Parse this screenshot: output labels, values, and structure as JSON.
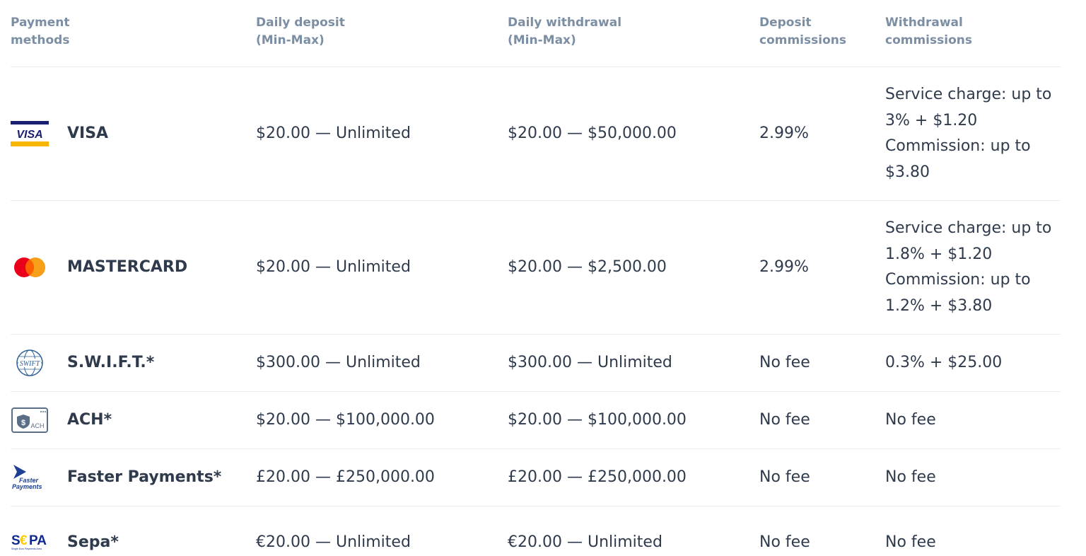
{
  "headers": {
    "method": "Payment\nmethods",
    "deposit": "Daily deposit\n(Min-Max)",
    "withdrawal": "Daily withdrawal\n(Min-Max)",
    "deposit_commissions": "Deposit\ncommissions",
    "withdrawal_commissions": "Withdrawal\ncommissions"
  },
  "rows": [
    {
      "method": "VISA",
      "icon": "visa-logo",
      "deposit": "$20.00 — Unlimited",
      "withdrawal": "$20.00 — $50,000.00",
      "deposit_commission": "2.99%",
      "withdrawal_commission": [
        "Service charge: up to",
        "3% + $1.20",
        "Commission: up to",
        "$3.80"
      ]
    },
    {
      "method": "MASTERCARD",
      "icon": "mastercard-logo",
      "deposit": "$20.00 — Unlimited",
      "withdrawal": "$20.00 — $2,500.00",
      "deposit_commission": "2.99%",
      "withdrawal_commission": [
        "Service charge: up to",
        "1.8% + $1.20",
        "Commission: up to",
        "1.2% + $3.80"
      ]
    },
    {
      "method": "S.W.I.F.T.*",
      "icon": "swift-logo",
      "deposit": "$300.00 — Unlimited",
      "withdrawal": "$300.00 — Unlimited",
      "deposit_commission": "No fee",
      "withdrawal_commission": [
        "0.3% + $25.00"
      ]
    },
    {
      "method": "ACH*",
      "icon": "ach-logo",
      "deposit": "$20.00 — $100,000.00",
      "withdrawal": "$20.00 — $100,000.00",
      "deposit_commission": "No fee",
      "withdrawal_commission": [
        "No fee"
      ]
    },
    {
      "method": "Faster Payments*",
      "icon": "faster-payments-logo",
      "deposit": "£20.00 — £250,000.00",
      "withdrawal": "£20.00 — £250,000.00",
      "deposit_commission": "No fee",
      "withdrawal_commission": [
        "No fee"
      ]
    },
    {
      "method": "Sepa*",
      "icon": "sepa-logo",
      "deposit": "€20.00 — Unlimited",
      "withdrawal": "€20.00 — Unlimited",
      "deposit_commission": "No fee",
      "withdrawal_commission": [
        "No fee"
      ]
    }
  ],
  "logo_text": {
    "visa": "VISA",
    "swift": "SWIFT",
    "ach_symbol": "$",
    "ach": "ACH",
    "faster_line1": "Faster",
    "faster_line2": "Payments",
    "sepa_s": "S",
    "sepa_euro": "€",
    "sepa_pa": "PA",
    "sepa_sub": "Single Euro Payments Area"
  },
  "colors": {
    "text": "#2f3b4c",
    "header": "#7c8ea3",
    "divider": "#e9edf1",
    "visa_blue": "#1a1f71",
    "visa_gold": "#f7b600",
    "mc_red": "#eb001b",
    "mc_orange": "#f79e1b",
    "sepa_blue": "#10298e",
    "sepa_yellow": "#ffcc00"
  }
}
